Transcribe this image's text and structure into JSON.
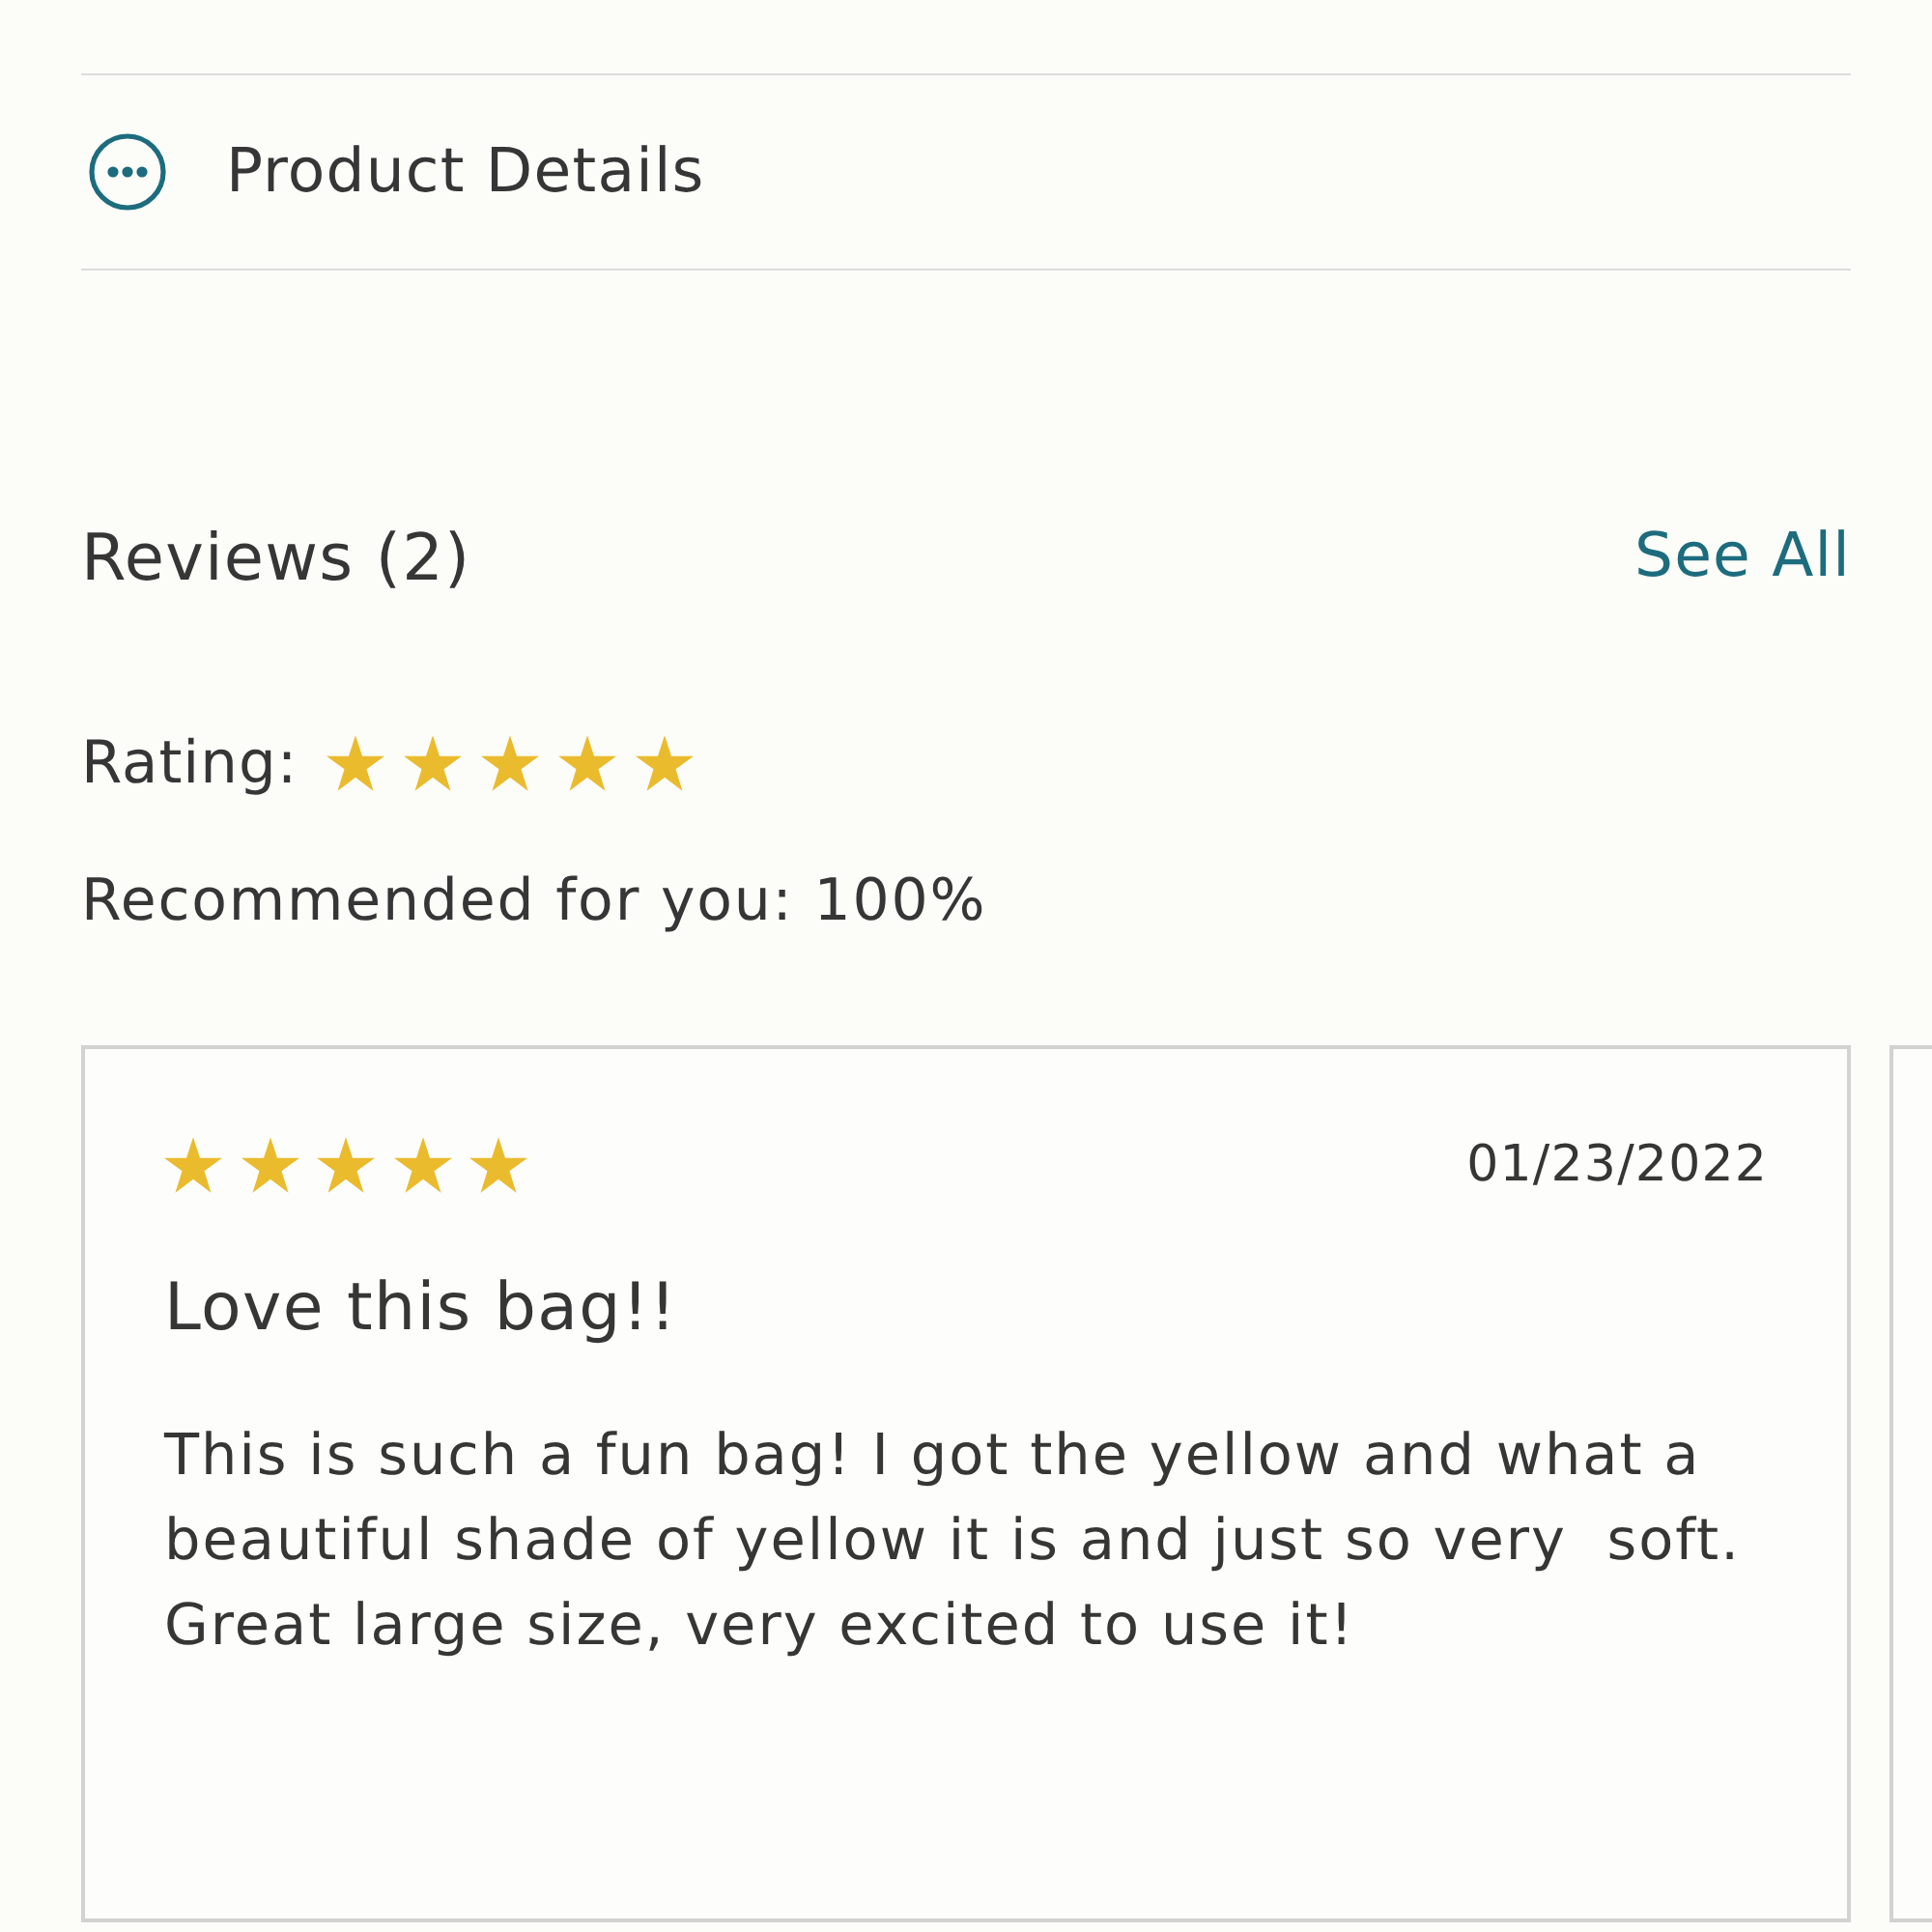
{
  "product_details": {
    "label": "Product Details"
  },
  "reviews": {
    "title": "Reviews (2)",
    "see_all": "See All",
    "rating": {
      "label": "Rating:",
      "stars": 5
    },
    "recommended": "Recommended for you: 100%",
    "cards": [
      {
        "stars": 5,
        "date": "01/23/2022",
        "title": "Love this bag!!",
        "body": "This is such a fun bag! I got the yellow and what a beautiful shade of yellow it is and just so very  soft. Great large size, very excited to use it!"
      }
    ],
    "next_card_visible": true
  }
}
